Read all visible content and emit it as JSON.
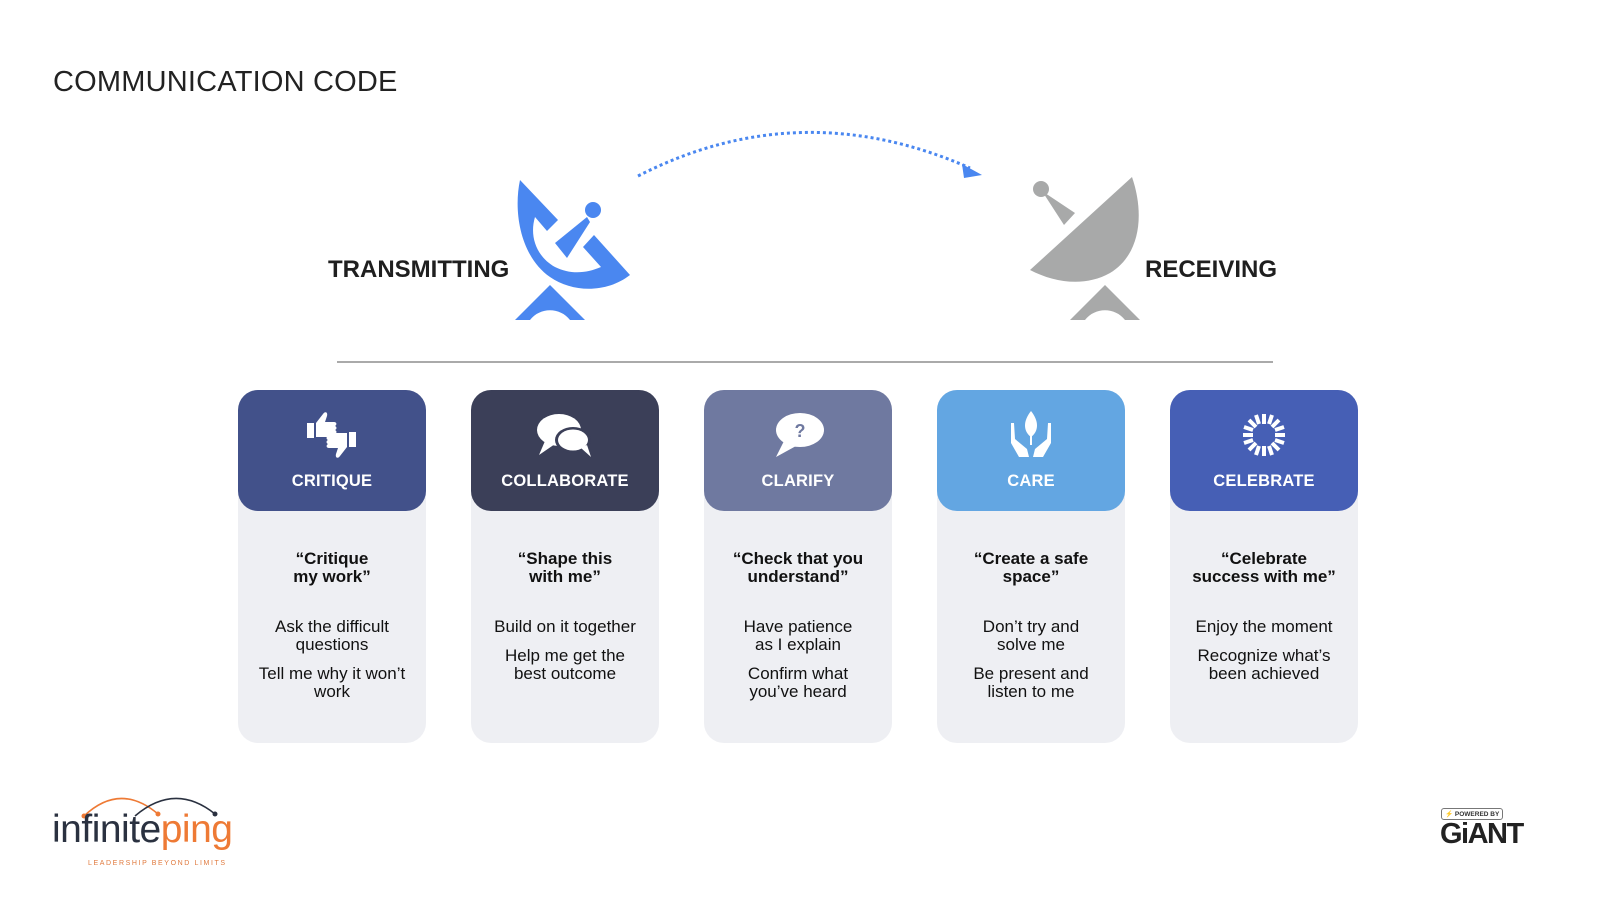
{
  "title": "COMMUNICATION CODE",
  "transmitting_label": "TRANSMITTING",
  "receiving_label": "RECEIVING",
  "colors": {
    "transmit": "#4a87f0",
    "receive": "#a8a9a9",
    "card_body": "#eeeff3"
  },
  "cards": [
    {
      "name": "CRITIQUE",
      "icon": "thumbs-up-down-icon",
      "color": "#42518a",
      "quote": "“Critique my work”",
      "quote_lines": [
        "“Critique",
        "my work”"
      ],
      "points": [
        [
          "Ask the difficult",
          "questions"
        ],
        [
          "Tell me why it won’t",
          "work"
        ]
      ]
    },
    {
      "name": "COLLABORATE",
      "icon": "chat-bubbles-icon",
      "color": "#3b3f58",
      "quote": "“Shape this with me”",
      "quote_lines": [
        "“Shape this",
        "with me”"
      ],
      "points": [
        [
          "Build on it together"
        ],
        [
          "Help me get the",
          "best outcome"
        ]
      ]
    },
    {
      "name": "CLARIFY",
      "icon": "question-bubble-icon",
      "color": "#6f79a0",
      "quote": "“Check that you understand”",
      "quote_lines": [
        "“Check that you",
        "understand”"
      ],
      "points": [
        [
          "Have patience",
          "as I explain"
        ],
        [
          "Confirm what",
          "you’ve heard"
        ]
      ]
    },
    {
      "name": "CARE",
      "icon": "hands-leaf-icon",
      "color": "#63a6e2",
      "quote": "“Create a safe space”",
      "quote_lines": [
        "“Create a safe",
        "space”"
      ],
      "points": [
        [
          "Don’t try and",
          "solve me"
        ],
        [
          "Be present and",
          "listen to me"
        ]
      ]
    },
    {
      "name": "CELEBRATE",
      "icon": "burst-icon",
      "color": "#465fb5",
      "quote": "“Celebrate success with me”",
      "quote_lines": [
        "“Celebrate",
        "success with me”"
      ],
      "points": [
        [
          "Enjoy the moment"
        ],
        [
          "Recognize what’s",
          "been achieved"
        ]
      ]
    }
  ],
  "footer": {
    "brand_part1": "infinite",
    "brand_part2": "ping",
    "tagline": "LEADERSHIP BEYOND LIMITS",
    "powered_by": "⚡ POWERED BY",
    "partner": "GiANT"
  }
}
